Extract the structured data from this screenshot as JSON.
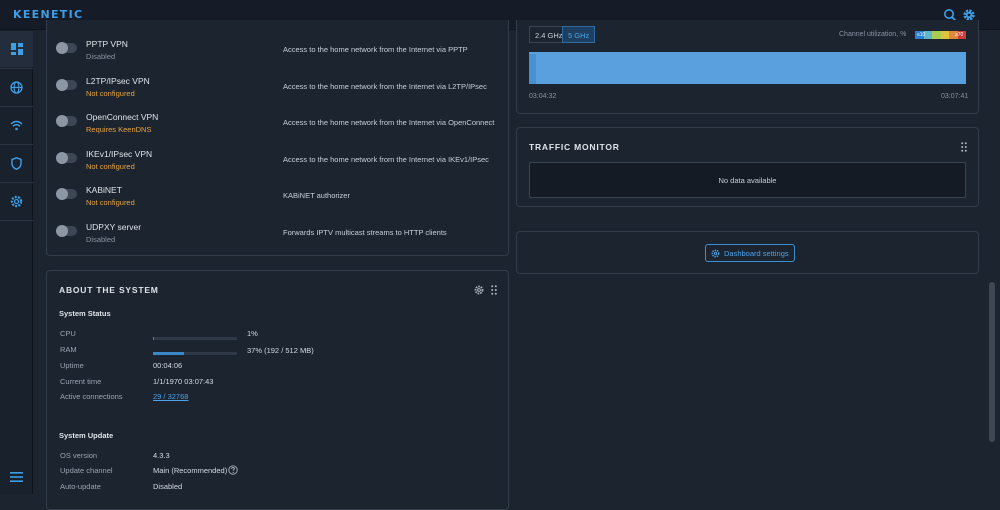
{
  "app": {
    "logo": "KEENETIC"
  },
  "colors": {
    "accent": "#3e9ee6",
    "warning": "#e8a43a",
    "muted": "#8a93a0"
  },
  "topbar": {
    "icons": [
      "search-icon",
      "gear-icon"
    ]
  },
  "sidebar": {
    "icons": [
      "dashboard-icon",
      "globe-icon",
      "wifi-icon",
      "shield-icon",
      "gear-icon",
      "menu-icon"
    ]
  },
  "vpn_list": [
    {
      "name": "PPTP VPN",
      "status": "Disabled",
      "status_type": "grey",
      "description": "Access to the home network from the Internet via PPTP"
    },
    {
      "name": "L2TP/IPsec VPN",
      "status": "Not configured",
      "status_type": "orange",
      "description": "Access to the home network from the Internet via L2TP/IPsec"
    },
    {
      "name": "OpenConnect VPN",
      "status": "Requires KeenDNS",
      "status_type": "orange",
      "description": "Access to the home network from the Internet via OpenConnect"
    },
    {
      "name": "IKEv1/IPsec VPN",
      "status": "Not configured",
      "status_type": "orange",
      "description": "Access to the home network from the Internet via IKEv1/IPsec"
    },
    {
      "name": "KABiNET",
      "status": "Not configured",
      "status_type": "orange",
      "description": "KABiNET authorizer"
    },
    {
      "name": "UDPXY server",
      "status": "Disabled",
      "status_type": "grey",
      "description": "Forwards IPTV multicast streams to HTTP clients"
    }
  ],
  "about": {
    "title": "ABOUT THE SYSTEM",
    "status_title": "System Status",
    "cpu": {
      "label": "CPU",
      "value": "1%",
      "fraction": 0.01
    },
    "ram": {
      "label": "RAM",
      "value": "37% (192 / 512 MB)",
      "fraction": 0.37
    },
    "uptime": {
      "label": "Uptime",
      "value": "00:04:06"
    },
    "current_time": {
      "label": "Current time",
      "value": "1/1/1970 03:07:43"
    },
    "connections": {
      "label": "Active connections",
      "value": "29 / 32768"
    },
    "update_title": "System Update",
    "os_version": {
      "label": "OS version",
      "value": "4.3.3"
    },
    "update_channel": {
      "label": "Update channel",
      "value": "Main (Recommended)"
    },
    "auto_update": {
      "label": "Auto-update",
      "value": "Disabled"
    }
  },
  "wifi": {
    "tabs": [
      "2.4 GHz",
      "5 GHz"
    ],
    "active_tab": "5 GHz",
    "utilization_label": "Channel utilization, %",
    "legend": {
      "low": "≤10",
      "high": "≥70"
    },
    "time_start": "03:04:32",
    "time_end": "03:07:41"
  },
  "traffic": {
    "title": "TRAFFIC MONITOR",
    "empty": "No data available"
  },
  "dashboard": {
    "settings_label": "Dashboard settings"
  }
}
